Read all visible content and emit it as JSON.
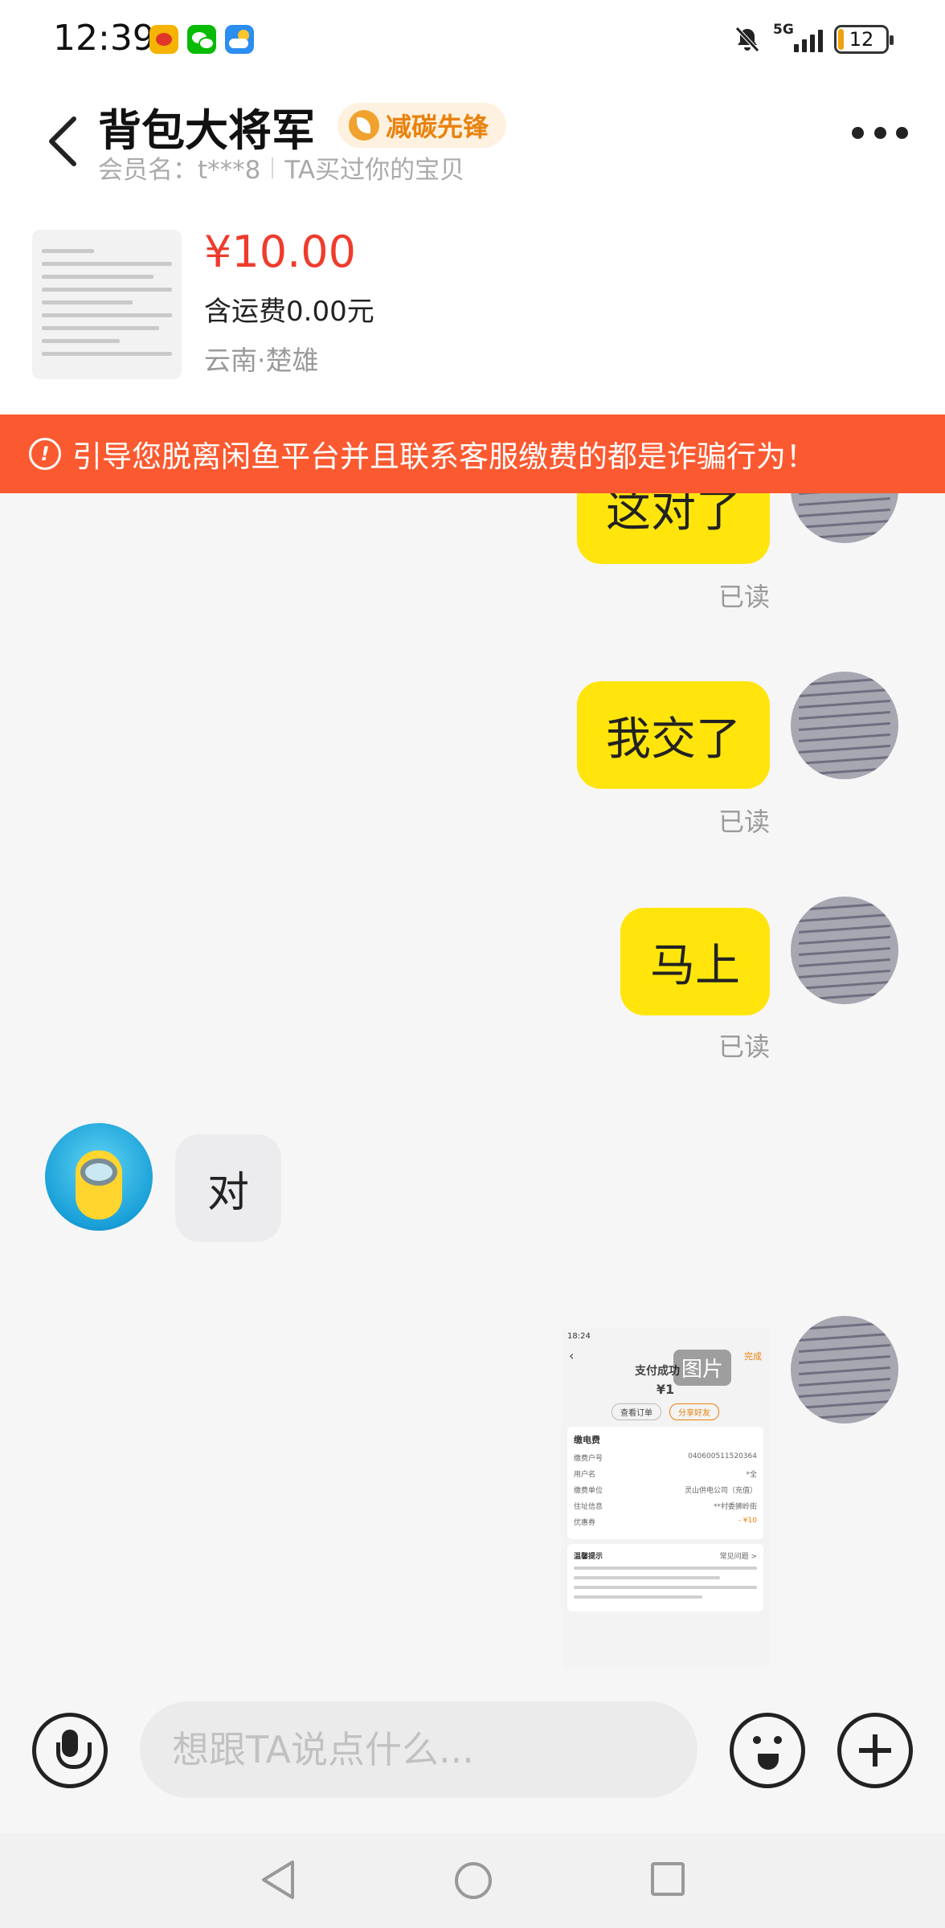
{
  "status_bar": {
    "time": "12:39",
    "network": "5G",
    "battery": "12",
    "battery_level": 0.12,
    "icons": [
      "weibo-icon",
      "wechat-icon",
      "weather-icon",
      "mute-icon",
      "signal-icon",
      "battery-icon"
    ]
  },
  "header": {
    "shop_name": "背包大将军",
    "badge": "减碳先锋",
    "member_label": "会员名：t***8",
    "member_note": "TA买过你的宝贝"
  },
  "product": {
    "price": "¥10.00",
    "shipping": "含运费0.00元",
    "location": "云南·楚雄"
  },
  "warning": {
    "text": "引导您脱离闲鱼平台并且联系客服缴费的都是诈骗行为！"
  },
  "messages": [
    {
      "from": "me",
      "text": "这对了",
      "status": "已读"
    },
    {
      "from": "me",
      "text": "我交了",
      "status": "已读"
    },
    {
      "from": "me",
      "text": "马上",
      "status": "已读"
    },
    {
      "from": "other",
      "text": "对"
    },
    {
      "from": "me",
      "type": "image",
      "tag": "图片",
      "image": {
        "status_time": "18:24",
        "done": "完成",
        "title": "支付成功",
        "amount": "¥1",
        "buttons": [
          "查看订单",
          "分享好友"
        ],
        "section": "缴电费",
        "rows": [
          {
            "label": "缴费户号",
            "value": "040600511520364"
          },
          {
            "label": "用户名",
            "value": "*全"
          },
          {
            "label": "缴费单位",
            "value": "灵山供电公司（充值）"
          },
          {
            "label": "住址信息",
            "value": "**村委狮岭街"
          },
          {
            "label": "优惠券",
            "value": "- ¥10"
          }
        ],
        "tips_title": "温馨提示",
        "tips_link": "常见问题 >"
      }
    }
  ],
  "input": {
    "placeholder": "想跟TA说点什么..."
  },
  "colors": {
    "my_bubble": "#ffe50c",
    "other_bubble": "#ececef",
    "warning_banner": "#fb5a31",
    "price": "#ee3c2c",
    "badge_text": "#e8820c"
  }
}
